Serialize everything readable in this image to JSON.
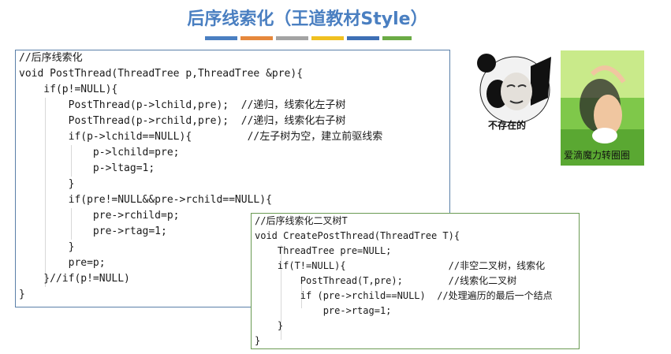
{
  "title": "后序线索化（王道教材Style）",
  "colors": [
    "#4a7fc1",
    "#e6883c",
    "#a3a3a3",
    "#f0c020",
    "#3d6fb5",
    "#6bab45"
  ],
  "panel_a_lines": [
    "//后序线索化",
    "void PostThread(ThreadTree p,ThreadTree &pre){",
    "    if(p!=NULL){",
    "        PostThread(p->lchild,pre);  //递归，线索化左子树",
    "        PostThread(p->rchild,pre);  //递归，线索化右子树",
    "        if(p->lchild==NULL){         //左子树为空，建立前驱线索",
    "            p->lchild=pre;",
    "            p->ltag=1;",
    "        }",
    "        if(pre!=NULL&&pre->rchild==NULL){",
    "            pre->rchild=p;",
    "            pre->rtag=1;",
    "        }",
    "        pre=p;",
    "    }//if(p!=NULL)",
    "}"
  ],
  "panel_b_lines": [
    "//后序线索化二叉树T",
    "void CreatePostThread(ThreadTree T){",
    "    ThreadTree pre=NULL;",
    "    if(T!=NULL){                  //非空二叉树，线索化",
    "        PostThread(T,pre);        //线索化二叉树",
    "        if (pre->rchild==NULL)  //处理遍历的最后一个结点",
    "            pre->rtag=1;",
    "    }",
    "}"
  ],
  "meme_left_caption": "不存在的",
  "meme_right_caption": "爱滴魔力转圈圈"
}
